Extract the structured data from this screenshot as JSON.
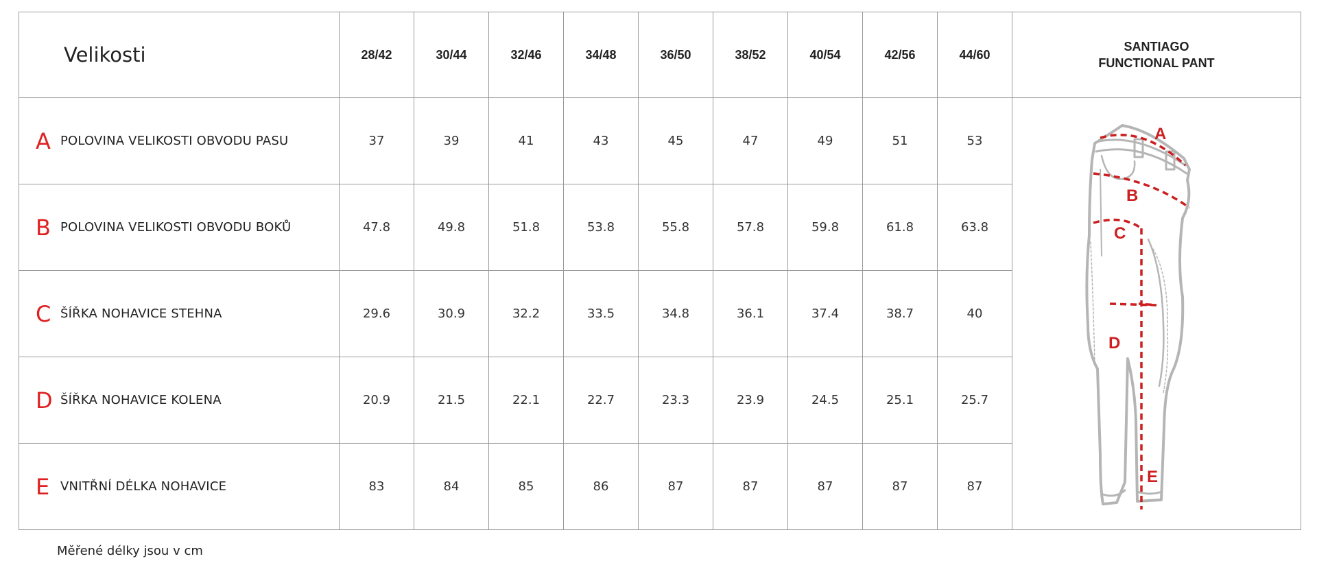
{
  "table": {
    "title": "Velikosti",
    "sizes": [
      "28/42",
      "30/44",
      "32/46",
      "34/48",
      "36/50",
      "38/52",
      "40/54",
      "42/56",
      "44/60"
    ],
    "product": {
      "line1": "SANTIAGO",
      "line2": "FUNCTIONAL PANT"
    },
    "rows": [
      {
        "letter": "A",
        "label": "POLOVINA VELIKOSTI OBVODU PASU",
        "values": [
          "37",
          "39",
          "41",
          "43",
          "45",
          "47",
          "49",
          "51",
          "53"
        ]
      },
      {
        "letter": "B",
        "label": "POLOVINA VELIKOSTI OBVODU BOKŮ",
        "values": [
          "47.8",
          "49.8",
          "51.8",
          "53.8",
          "55.8",
          "57.8",
          "59.8",
          "61.8",
          "63.8"
        ]
      },
      {
        "letter": "C",
        "label": "ŠÍŘKA NOHAVICE STEHNA",
        "values": [
          "29.6",
          "30.9",
          "32.2",
          "33.5",
          "34.8",
          "36.1",
          "37.4",
          "38.7",
          "40"
        ]
      },
      {
        "letter": "D",
        "label": "ŠÍŘKA NOHAVICE KOLENA",
        "values": [
          "20.9",
          "21.5",
          "22.1",
          "22.7",
          "23.3",
          "23.9",
          "24.5",
          "25.1",
          "25.7"
        ]
      },
      {
        "letter": "E",
        "label": "VNITŘNÍ DÉLKA NOHAVICE",
        "values": [
          "83",
          "84",
          "85",
          "86",
          "87",
          "87",
          "87",
          "87",
          "87"
        ]
      }
    ]
  },
  "figure": {
    "markers": [
      "A",
      "B",
      "C",
      "D",
      "E"
    ],
    "accent_color": "#cc1f1f",
    "outline_color": "#b5b5b5"
  },
  "footnote": "Měřené délky jsou v cm"
}
